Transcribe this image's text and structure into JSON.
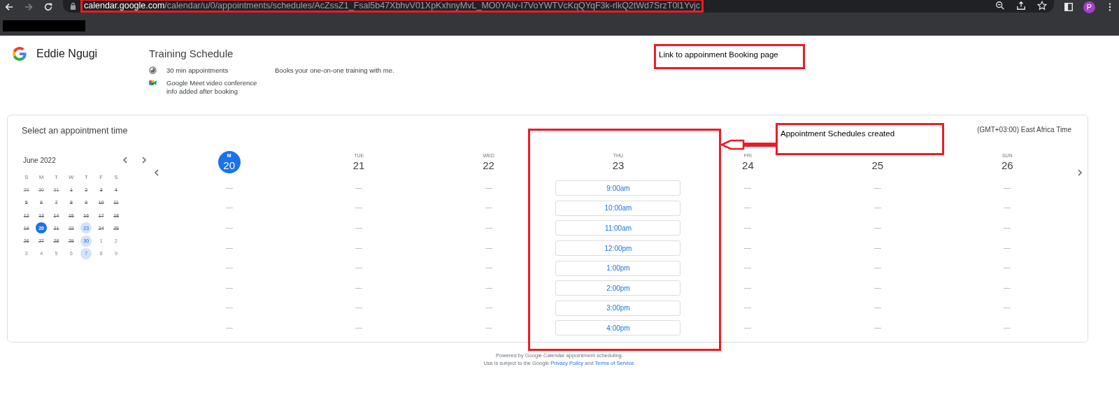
{
  "browser": {
    "url_host": "calendar.google.com",
    "url_path": "/calendar/u/0/appointments/schedules/AcZssZ1_Fsal5b47XbhvV01XpKxhnyMvL_MO0YAlv-I7VoYWTVcKqQYqF3k-rlkQ2tWd7SrzT0l1Yvjc",
    "url_highlighted": true,
    "forward_disabled": true,
    "profile_initial": "P"
  },
  "header": {
    "owner": "Eddie Ngugi",
    "title": "Training Schedule",
    "duration": "30 min appointments",
    "conference": "Google Meet video conference info added after booking",
    "description": "Books your one-on-one training with me."
  },
  "booking": {
    "heading": "Select an appointment time",
    "timezone": "(GMT+03:00) East Africa Time",
    "mini_calendar": {
      "month": "June 2022",
      "weekdays": [
        "S",
        "M",
        "T",
        "W",
        "T",
        "F",
        "S"
      ],
      "days": [
        {
          "day": "29",
          "kind": "struck",
          "other_month": true,
          "selected": false
        },
        {
          "day": "30",
          "kind": "struck",
          "other_month": true,
          "selected": false
        },
        {
          "day": "31",
          "kind": "struck",
          "other_month": true,
          "selected": false
        },
        {
          "day": "1",
          "kind": "struck",
          "other_month": false,
          "selected": false
        },
        {
          "day": "2",
          "kind": "struck",
          "other_month": false,
          "selected": false
        },
        {
          "day": "3",
          "kind": "struck",
          "other_month": false,
          "selected": false
        },
        {
          "day": "4",
          "kind": "struck",
          "other_month": false,
          "selected": false
        },
        {
          "day": "5",
          "kind": "struck",
          "other_month": false,
          "selected": false
        },
        {
          "day": "6",
          "kind": "struck",
          "other_month": false,
          "selected": false
        },
        {
          "day": "7",
          "kind": "struck",
          "other_month": false,
          "selected": false
        },
        {
          "day": "8",
          "kind": "struck",
          "other_month": false,
          "selected": false
        },
        {
          "day": "9",
          "kind": "struck",
          "other_month": false,
          "selected": false
        },
        {
          "day": "10",
          "kind": "struck",
          "other_month": false,
          "selected": false
        },
        {
          "day": "11",
          "kind": "struck",
          "other_month": false,
          "selected": false
        },
        {
          "day": "12",
          "kind": "struck",
          "other_month": false,
          "selected": false
        },
        {
          "day": "13",
          "kind": "struck",
          "other_month": false,
          "selected": false
        },
        {
          "day": "14",
          "kind": "struck",
          "other_month": false,
          "selected": false
        },
        {
          "day": "15",
          "kind": "struck",
          "other_month": false,
          "selected": false
        },
        {
          "day": "16",
          "kind": "struck",
          "other_month": false,
          "selected": false
        },
        {
          "day": "17",
          "kind": "struck",
          "other_month": false,
          "selected": false
        },
        {
          "day": "18",
          "kind": "struck",
          "other_month": false,
          "selected": false
        },
        {
          "day": "19",
          "kind": "struck",
          "other_month": false,
          "selected": false
        },
        {
          "day": "20",
          "kind": "available",
          "other_month": false,
          "selected": true
        },
        {
          "day": "21",
          "kind": "struck",
          "other_month": false,
          "selected": false
        },
        {
          "day": "22",
          "kind": "struck",
          "other_month": false,
          "selected": false
        },
        {
          "day": "23",
          "kind": "available",
          "other_month": false,
          "selected": false
        },
        {
          "day": "24",
          "kind": "struck",
          "other_month": false,
          "selected": false
        },
        {
          "day": "25",
          "kind": "struck",
          "other_month": false,
          "selected": false
        },
        {
          "day": "26",
          "kind": "struck",
          "other_month": false,
          "selected": false
        },
        {
          "day": "27",
          "kind": "struck",
          "other_month": false,
          "selected": false
        },
        {
          "day": "28",
          "kind": "struck",
          "other_month": false,
          "selected": false
        },
        {
          "day": "29",
          "kind": "struck",
          "other_month": false,
          "selected": false
        },
        {
          "day": "30",
          "kind": "available",
          "other_month": false,
          "selected": false
        },
        {
          "day": "1",
          "kind": "plain",
          "other_month": true,
          "selected": false
        },
        {
          "day": "2",
          "kind": "plain",
          "other_month": true,
          "selected": false
        },
        {
          "day": "3",
          "kind": "plain",
          "other_month": true,
          "selected": false
        },
        {
          "day": "4",
          "kind": "plain",
          "other_month": true,
          "selected": false
        },
        {
          "day": "5",
          "kind": "plain",
          "other_month": true,
          "selected": false
        },
        {
          "day": "6",
          "kind": "plain",
          "other_month": true,
          "selected": false
        },
        {
          "day": "7",
          "kind": "available",
          "other_month": true,
          "selected": false
        },
        {
          "day": "8",
          "kind": "plain",
          "other_month": true,
          "selected": false
        },
        {
          "day": "9",
          "kind": "plain",
          "other_month": true,
          "selected": false
        }
      ]
    },
    "week": [
      {
        "name": "M",
        "date": "20",
        "selected": true,
        "slots": [
          {
            "kind": "empty"
          },
          {
            "kind": "empty"
          },
          {
            "kind": "empty"
          },
          {
            "kind": "empty"
          },
          {
            "kind": "empty"
          },
          {
            "kind": "empty"
          },
          {
            "kind": "empty"
          },
          {
            "kind": "empty"
          }
        ]
      },
      {
        "name": "TUE",
        "date": "21",
        "selected": false,
        "slots": [
          {
            "kind": "empty"
          },
          {
            "kind": "empty"
          },
          {
            "kind": "empty"
          },
          {
            "kind": "empty"
          },
          {
            "kind": "empty"
          },
          {
            "kind": "empty"
          },
          {
            "kind": "empty"
          },
          {
            "kind": "empty"
          }
        ]
      },
      {
        "name": "WED",
        "date": "22",
        "selected": false,
        "slots": [
          {
            "kind": "empty"
          },
          {
            "kind": "empty"
          },
          {
            "kind": "empty"
          },
          {
            "kind": "empty"
          },
          {
            "kind": "empty"
          },
          {
            "kind": "empty"
          },
          {
            "kind": "empty"
          },
          {
            "kind": "empty"
          }
        ]
      },
      {
        "name": "THU",
        "date": "23",
        "selected": false,
        "slots": [
          {
            "kind": "time",
            "time": "9:00am"
          },
          {
            "kind": "time",
            "time": "10:00am"
          },
          {
            "kind": "time",
            "time": "11:00am"
          },
          {
            "kind": "time",
            "time": "12:00pm"
          },
          {
            "kind": "time",
            "time": "1:00pm"
          },
          {
            "kind": "time",
            "time": "2:00pm"
          },
          {
            "kind": "time",
            "time": "3:00pm"
          },
          {
            "kind": "time",
            "time": "4:00pm"
          }
        ]
      },
      {
        "name": "FRI",
        "date": "24",
        "selected": false,
        "slots": [
          {
            "kind": "empty"
          },
          {
            "kind": "empty"
          },
          {
            "kind": "empty"
          },
          {
            "kind": "empty"
          },
          {
            "kind": "empty"
          },
          {
            "kind": "empty"
          },
          {
            "kind": "empty"
          },
          {
            "kind": "empty"
          }
        ]
      },
      {
        "date": "25",
        "selected": false,
        "slots": [
          {
            "kind": "empty"
          },
          {
            "kind": "empty"
          },
          {
            "kind": "empty"
          },
          {
            "kind": "empty"
          },
          {
            "kind": "empty"
          },
          {
            "kind": "empty"
          },
          {
            "kind": "empty"
          },
          {
            "kind": "empty"
          }
        ]
      },
      {
        "name": "SUN",
        "date": "26",
        "selected": false,
        "slots": [
          {
            "kind": "empty"
          },
          {
            "kind": "empty"
          },
          {
            "kind": "empty"
          },
          {
            "kind": "empty"
          },
          {
            "kind": "empty"
          },
          {
            "kind": "empty"
          },
          {
            "kind": "empty"
          },
          {
            "kind": "empty"
          }
        ]
      }
    ]
  },
  "footer": {
    "line1": "Powered by Google Calendar appointment scheduling.",
    "line2": [
      {
        "kind": "text",
        "text": "Use is subject to the Google "
      },
      {
        "kind": "link",
        "text": "Privacy Policy"
      },
      {
        "kind": "text",
        "text": " and "
      },
      {
        "kind": "link",
        "text": "Terms of Service"
      },
      {
        "kind": "text",
        "text": "."
      }
    ]
  },
  "annotations": [
    {
      "kind": "box",
      "text": "Link to appoinment Booking page"
    },
    {
      "kind": "frame"
    },
    {
      "kind": "arrow"
    },
    {
      "kind": "box",
      "text": "Appointment Schedules created"
    }
  ]
}
